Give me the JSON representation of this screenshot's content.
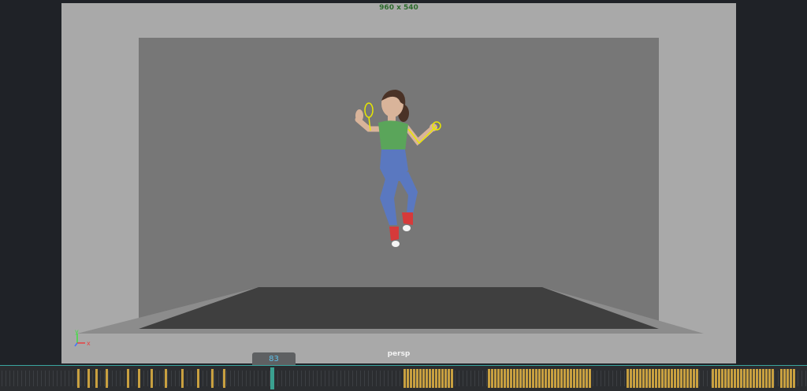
{
  "viewport": {
    "resolution_label": "960 x 540",
    "camera_label": "persp",
    "axis_gizmo": {
      "x_label": "x",
      "y_label": "y",
      "x_color": "#e84040",
      "y_color": "#40e040",
      "z_color": "#4070ff"
    }
  },
  "timeline": {
    "current_frame": "83",
    "keyframe_color": "#c8a040",
    "current_frame_color": "#3aa090"
  },
  "character": {
    "shirt_color": "#5aa55a",
    "pants_color": "#5a78c0",
    "shoe_color": "#d63a3a",
    "skin_color": "#d9b49a",
    "hair_color": "#4a3226",
    "control_color": "#e8e800"
  }
}
